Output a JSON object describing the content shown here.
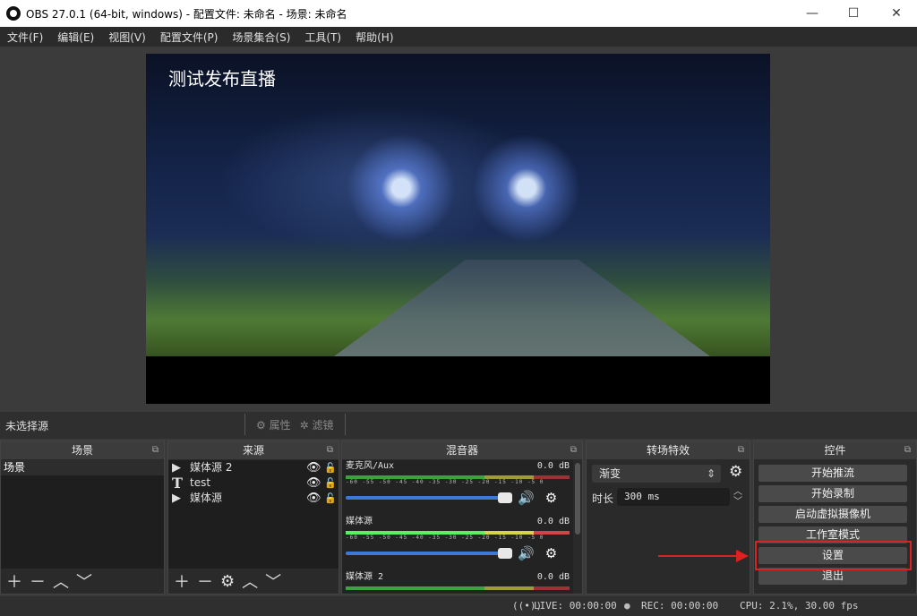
{
  "window": {
    "title": "OBS 27.0.1 (64-bit, windows) - 配置文件: 未命名 - 场景: 未命名",
    "minimize": "—",
    "maximize": "☐",
    "close": "✕"
  },
  "menu": [
    "文件(F)",
    "编辑(E)",
    "视图(V)",
    "配置文件(P)",
    "场景集合(S)",
    "工具(T)",
    "帮助(H)"
  ],
  "preview": {
    "overlay_text": "测试发布直播"
  },
  "status": {
    "no_source": "未选择源",
    "properties": "属性",
    "filters": "滤镜"
  },
  "docks": {
    "scenes": {
      "title": "场景",
      "items": [
        "场景"
      ]
    },
    "sources": {
      "title": "来源",
      "items": [
        {
          "type": "media",
          "type_icon": "▶",
          "name": "媒体源 2"
        },
        {
          "type": "text",
          "type_icon": "T",
          "name": "test"
        },
        {
          "type": "media",
          "type_icon": "▶",
          "name": "媒体源"
        }
      ]
    },
    "mixer": {
      "title": "混音器",
      "channels": [
        {
          "name": "麦克风/Aux",
          "level": "0.0 dB",
          "ticks": "-60 -55 -50 -45 -40 -35 -30 -25 -20 -15 -10 -5 0"
        },
        {
          "name": "媒体源",
          "level": "0.0 dB",
          "ticks": "-60 -55 -50 -45 -40 -35 -30 -25 -20 -15 -10 -5 0"
        },
        {
          "name": "媒体源 2",
          "level": "0.0 dB"
        }
      ]
    },
    "transitions": {
      "title": "转场特效",
      "type": "渐变",
      "duration_label": "时长",
      "duration": "300 ms"
    },
    "controls": {
      "title": "控件",
      "buttons": [
        "开始推流",
        "开始录制",
        "启动虚拟摄像机",
        "工作室模式",
        "设置",
        "退出"
      ]
    }
  },
  "statusbar": {
    "live": "LIVE: 00:00:00",
    "rec": "REC: 00:00:00",
    "cpu": "CPU: 2.1%, 30.00 fps"
  },
  "colors": {
    "highlight": "#e02020",
    "slider": "#3b7ad8"
  }
}
